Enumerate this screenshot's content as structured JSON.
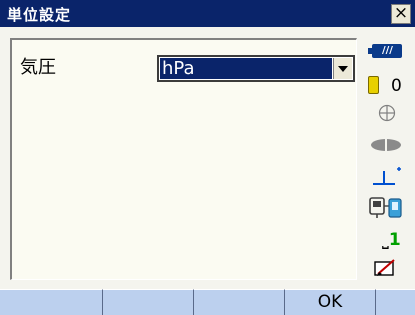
{
  "window": {
    "title": "単位設定",
    "close_label": "×"
  },
  "settings": {
    "pressure_label": "気圧",
    "pressure_unit_selected": "hPa"
  },
  "status": {
    "battery_text": "///",
    "prism_constant": "0",
    "page_prefix": "⎵",
    "page_number": "1",
    "icons": [
      "battery-icon",
      "prism-icon",
      "target-icon",
      "laser-icon",
      "tilt-icon",
      "bluetooth-device-icon",
      "input-mode-icon"
    ]
  },
  "softkeys": [
    "",
    "",
    "",
    "OK",
    ""
  ]
}
